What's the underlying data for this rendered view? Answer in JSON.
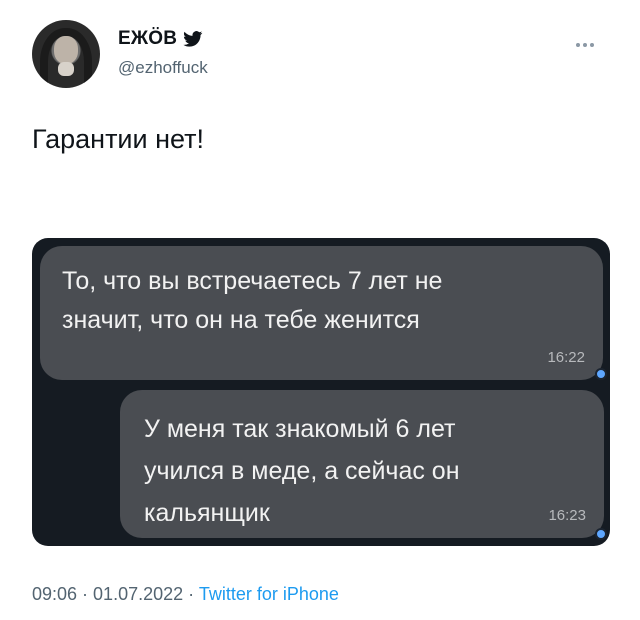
{
  "author": {
    "name": "ЕЖÖВ",
    "handle": "@ezhoffuck",
    "verified_icon": "twitter-bird-icon"
  },
  "tweet": {
    "text": "Гарантии нет!"
  },
  "chat": {
    "messages": [
      {
        "text_line1": "То, что вы встречаетесь 7 лет не",
        "text_line2": "значит, что он на тебе женится",
        "time": "16:22"
      },
      {
        "text_line1": "У меня так знакомый 6 лет",
        "text_line2": "учился в меде, а сейчас он",
        "text_line3": "кальянщик",
        "time": "16:23"
      }
    ]
  },
  "meta": {
    "time": "09:06",
    "separator": " · ",
    "date": "01.07.2022",
    "source": "Twitter for iPhone"
  },
  "colors": {
    "accent": "#1d9bf0",
    "bubble": "#4a4d52",
    "chat_bg": "#151b22"
  }
}
